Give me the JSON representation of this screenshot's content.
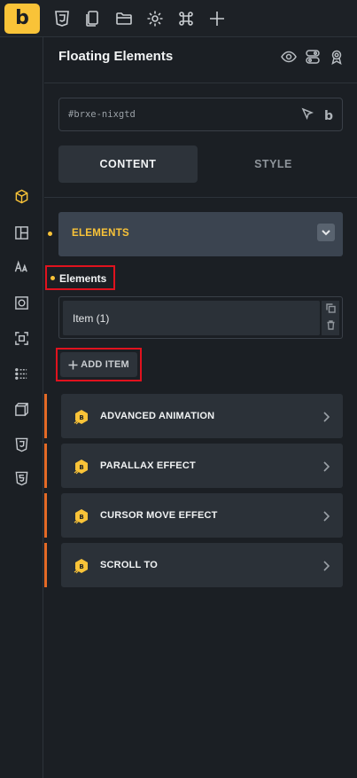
{
  "topbar": {
    "logo_letter": "b",
    "icons": [
      "css3-icon",
      "pages-icon",
      "folder-icon",
      "settings-icon",
      "command-icon",
      "plus-icon"
    ]
  },
  "leftbar": {
    "icons": [
      "cube-icon",
      "layout-icon",
      "typography-icon",
      "border-icon",
      "spacing-icon",
      "grid-dots-icon",
      "transform-icon",
      "css3-icon",
      "html5-icon"
    ],
    "active": "cube-icon"
  },
  "panel": {
    "title": "Floating Elements",
    "element_id": "#brxe-nixgtd",
    "id_logo": "b",
    "tabs": [
      {
        "label": "CONTENT",
        "active": true
      },
      {
        "label": "STYLE",
        "active": false
      }
    ],
    "group": {
      "label": "ELEMENTS"
    },
    "field_label": "Elements",
    "repeater_items": [
      {
        "label": "Item (1)"
      }
    ],
    "add_item_label": "ADD ITEM",
    "sections": [
      {
        "label": "ADVANCED ANIMATION"
      },
      {
        "label": "PARALLAX EFFECT"
      },
      {
        "label": "CURSOR MOVE EFFECT"
      },
      {
        "label": "SCROLL TO"
      }
    ]
  },
  "colors": {
    "accent_yellow": "#f9c338",
    "accent_orange": "#e46a26",
    "highlight_red": "#e0121e",
    "background": "#1b1f24"
  }
}
